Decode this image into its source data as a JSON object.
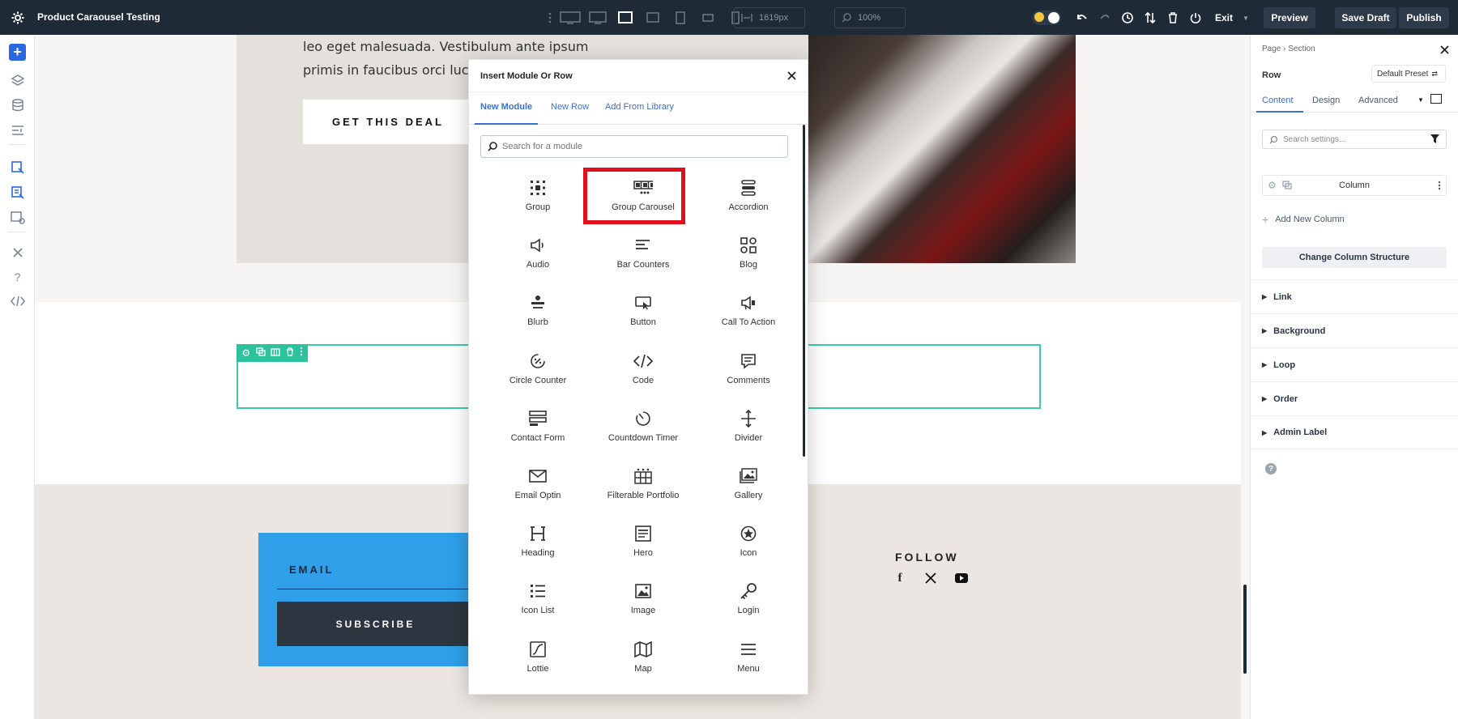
{
  "topbar": {
    "title": "Product Caraousel Testing",
    "width_value": "1619px",
    "zoom_value": "100%",
    "exit_label": "Exit",
    "preview_label": "Preview",
    "save_draft_label": "Save Draft",
    "publish_label": "Publish"
  },
  "page": {
    "hero_line1": "leo eget malesuada. Vestibulum ante ipsum",
    "hero_line2": "primis in faucibus orci luctu",
    "deal_button": "GET THIS DEAL",
    "email_label": "EMAIL",
    "subscribe_button": "SUBSCRIBE",
    "follow_label": "FOLLOW"
  },
  "modal": {
    "title": "Insert Module Or Row",
    "tabs": [
      "New Module",
      "New Row",
      "Add From Library"
    ],
    "search_placeholder": "Search for a module",
    "modules": [
      {
        "label": "Group",
        "icon": "group-icon"
      },
      {
        "label": "Group Carousel",
        "icon": "group-carousel-icon"
      },
      {
        "label": "Accordion",
        "icon": "accordion-icon"
      },
      {
        "label": "Audio",
        "icon": "audio-icon"
      },
      {
        "label": "Bar Counters",
        "icon": "bar-counters-icon"
      },
      {
        "label": "Blog",
        "icon": "blog-icon"
      },
      {
        "label": "Blurb",
        "icon": "blurb-icon"
      },
      {
        "label": "Button",
        "icon": "button-icon"
      },
      {
        "label": "Call To Action",
        "icon": "call-to-action-icon"
      },
      {
        "label": "Circle Counter",
        "icon": "circle-counter-icon"
      },
      {
        "label": "Code",
        "icon": "code-icon"
      },
      {
        "label": "Comments",
        "icon": "comments-icon"
      },
      {
        "label": "Contact Form",
        "icon": "contact-form-icon"
      },
      {
        "label": "Countdown Timer",
        "icon": "countdown-timer-icon"
      },
      {
        "label": "Divider",
        "icon": "divider-icon"
      },
      {
        "label": "Email Optin",
        "icon": "email-optin-icon"
      },
      {
        "label": "Filterable Portfolio",
        "icon": "filterable-portfolio-icon"
      },
      {
        "label": "Gallery",
        "icon": "gallery-icon"
      },
      {
        "label": "Heading",
        "icon": "heading-icon"
      },
      {
        "label": "Hero",
        "icon": "hero-icon"
      },
      {
        "label": "Icon",
        "icon": "icon-icon"
      },
      {
        "label": "Icon List",
        "icon": "icon-list-icon"
      },
      {
        "label": "Image",
        "icon": "image-icon"
      },
      {
        "label": "Login",
        "icon": "login-icon"
      },
      {
        "label": "Lottie",
        "icon": "lottie-icon"
      },
      {
        "label": "Map",
        "icon": "map-icon"
      },
      {
        "label": "Menu",
        "icon": "menu-icon"
      }
    ]
  },
  "right_panel": {
    "breadcrumb_page": "Page",
    "breadcrumb_section": "Section",
    "element_label": "Row",
    "preset_label": "Default Preset",
    "tabs": [
      "Content",
      "Design",
      "Advanced"
    ],
    "search_placeholder": "Search settings...",
    "column_label": "Column",
    "add_column_label": "Add New Column",
    "change_structure_label": "Change Column Structure",
    "accordions": [
      "Link",
      "Background",
      "Loop",
      "Order",
      "Admin Label"
    ]
  },
  "colors": {
    "topbar_bg": "#1f2a37",
    "accent_blue": "#3b6fd1",
    "row_outline": "#3ec9a7",
    "highlight_red": "#e0101a",
    "email_box": "#2e9fe8"
  }
}
